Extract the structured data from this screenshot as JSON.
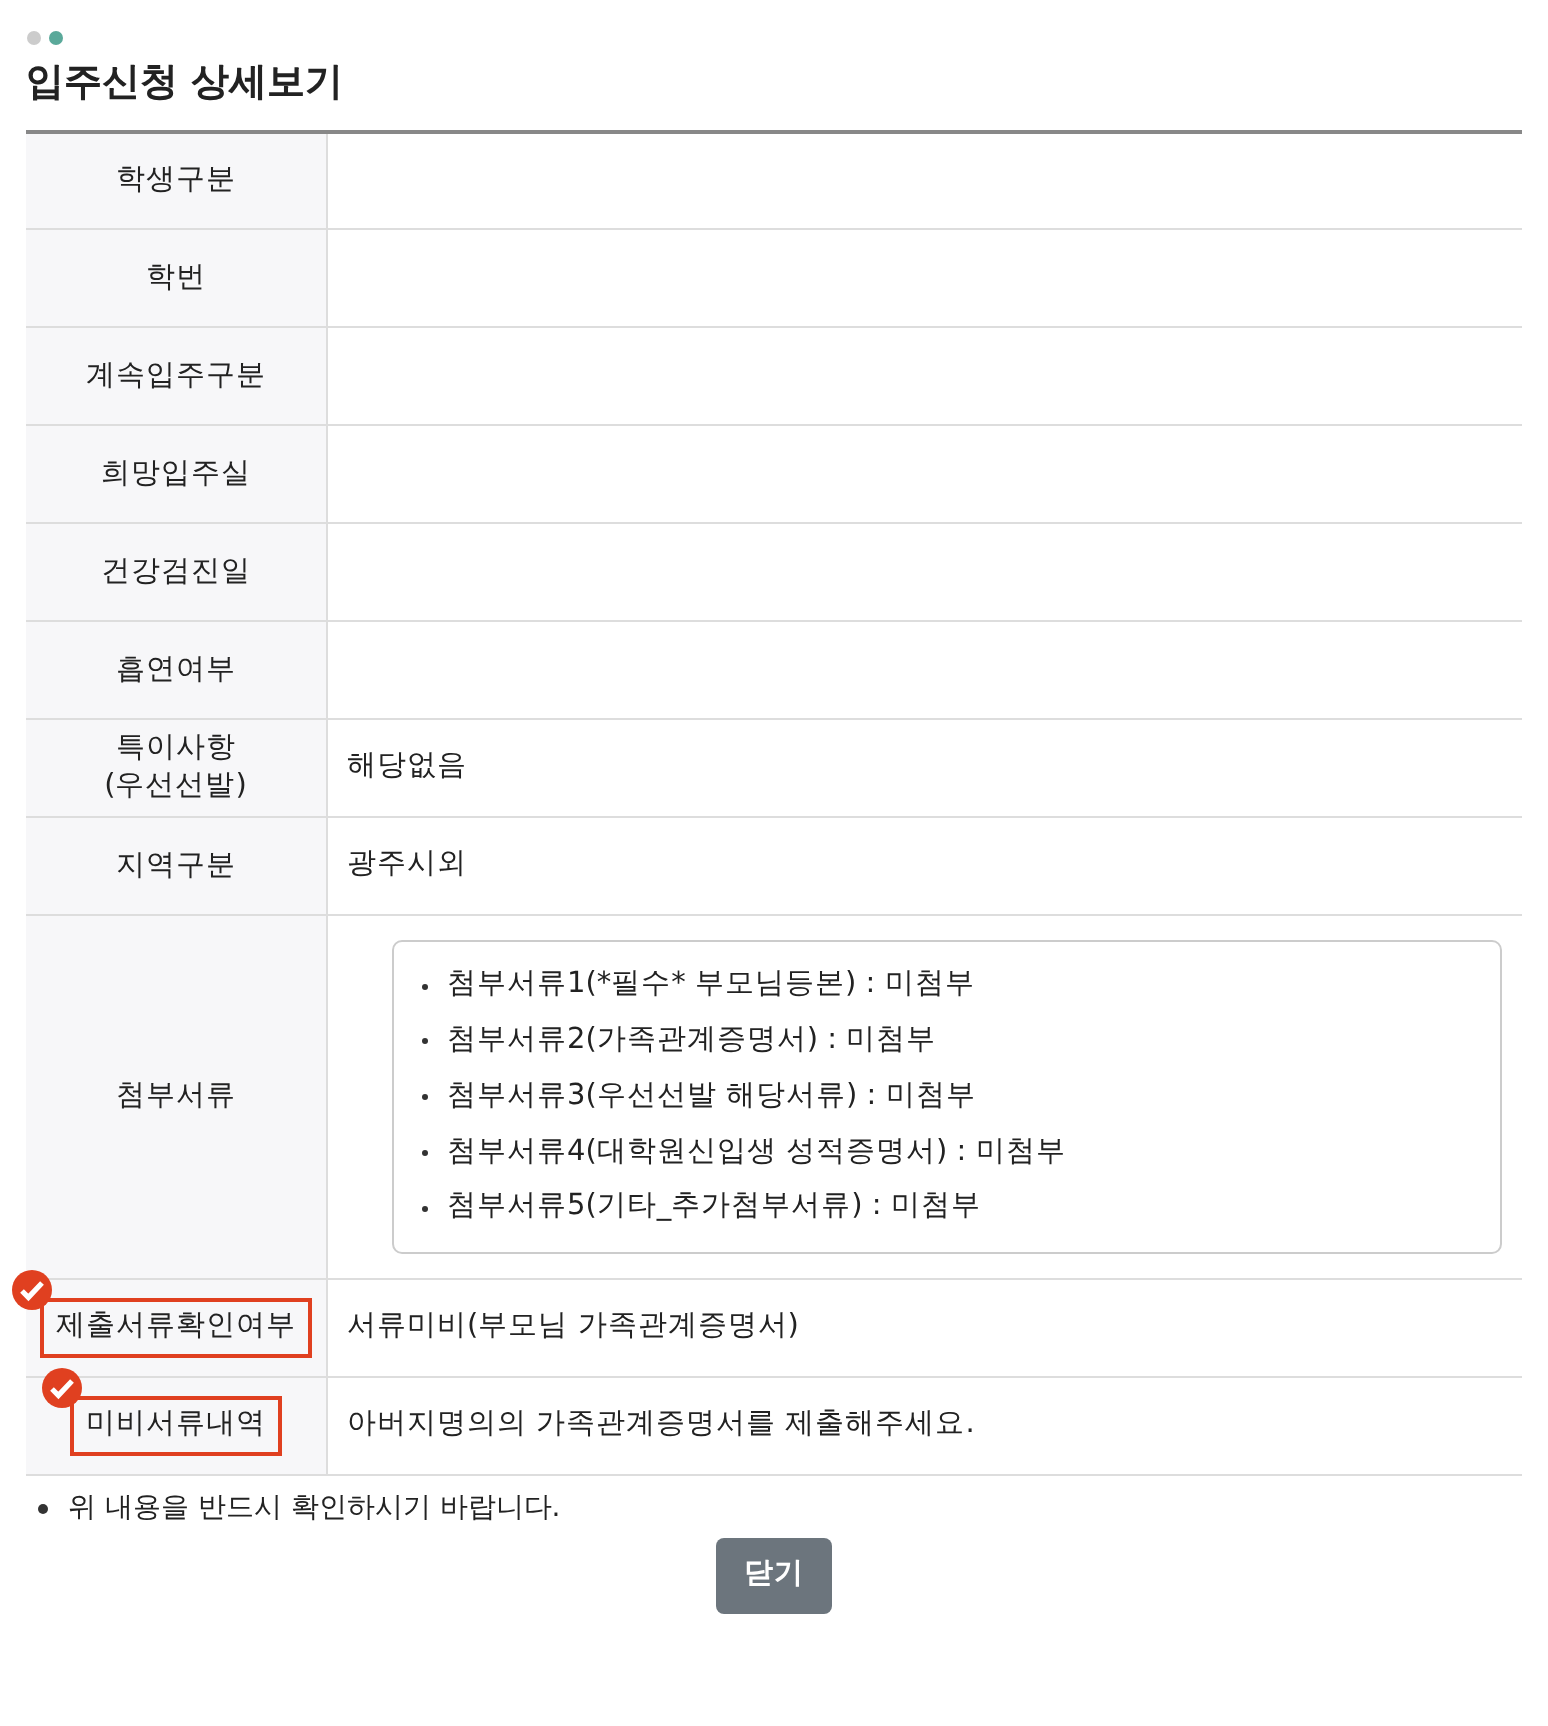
{
  "title": "입주신청 상세보기",
  "rows": [
    {
      "label": "학생구분",
      "value": "",
      "highlighted": false
    },
    {
      "label": "학번",
      "value": "",
      "highlighted": false
    },
    {
      "label": "계속입주구분",
      "value": "",
      "highlighted": false
    },
    {
      "label": "희망입주실",
      "value": "",
      "highlighted": false
    },
    {
      "label": "건강검진일",
      "value": "",
      "highlighted": false
    },
    {
      "label": "흡연여부",
      "value": "",
      "highlighted": false
    },
    {
      "label": "특이사항\n(우선선발)",
      "value": "해당없음",
      "highlighted": false
    },
    {
      "label": "지역구분",
      "value": "광주시외",
      "highlighted": false
    },
    {
      "label": "첨부서류",
      "kind": "list",
      "highlighted": false,
      "items": [
        "첨부서류1(*필수* 부모님등본) : 미첨부",
        "첨부서류2(가족관계증명서) : 미첨부",
        "첨부서류3(우선선발 해당서류) : 미첨부",
        "첨부서류4(대학원신입생 성적증명서) : 미첨부",
        "첨부서류5(기타_추가첨부서류) : 미첨부"
      ]
    },
    {
      "label": "제출서류확인여부",
      "value": "서류미비(부모님 가족관계증명서)",
      "highlighted": true
    },
    {
      "label": "미비서류내역",
      "value": "아버지명의의 가족관계증명서를 제출해주세요.",
      "highlighted": true
    }
  ],
  "notice": "위 내용을 반드시 확인하시기 바랍니다.",
  "close_button": "닫기"
}
